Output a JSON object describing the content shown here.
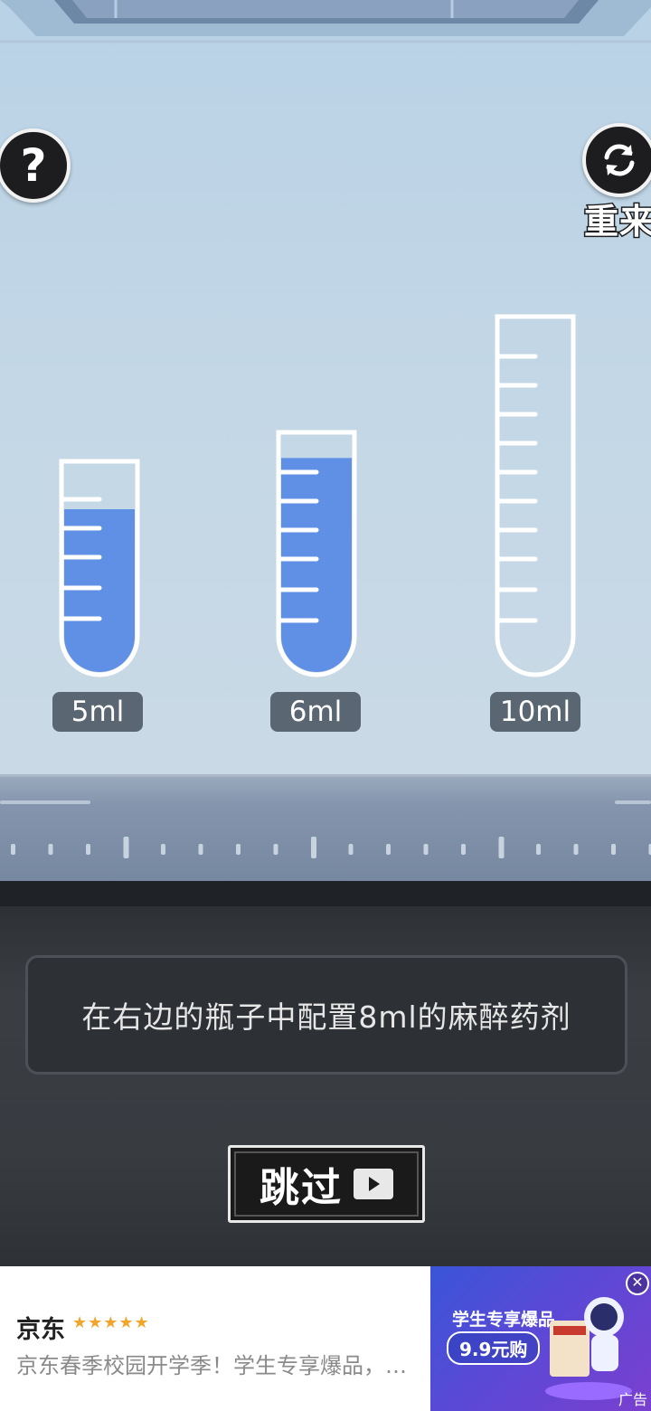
{
  "hud": {
    "help_symbol": "?",
    "restart_label": "重来"
  },
  "tubes": [
    {
      "capacity_label": "5ml",
      "fill_fraction": 0.78
    },
    {
      "capacity_label": "6ml",
      "fill_fraction": 0.9
    },
    {
      "capacity_label": "10ml",
      "fill_fraction": 0
    }
  ],
  "instruction": "在右边的瓶子中配置8ml的麻醉药剂",
  "skip": {
    "label": "跳过"
  },
  "ad": {
    "brand": "京东",
    "stars": "★★★★★",
    "description": "京东春季校园开学季！学生专享爆品，…",
    "headline": "学生专享爆品",
    "price": "9.9元购",
    "tag": "广告"
  },
  "colors": {
    "liquid": "#5f90e6",
    "tube_outline": "#ffffff",
    "label_bg": "#5a6672"
  }
}
